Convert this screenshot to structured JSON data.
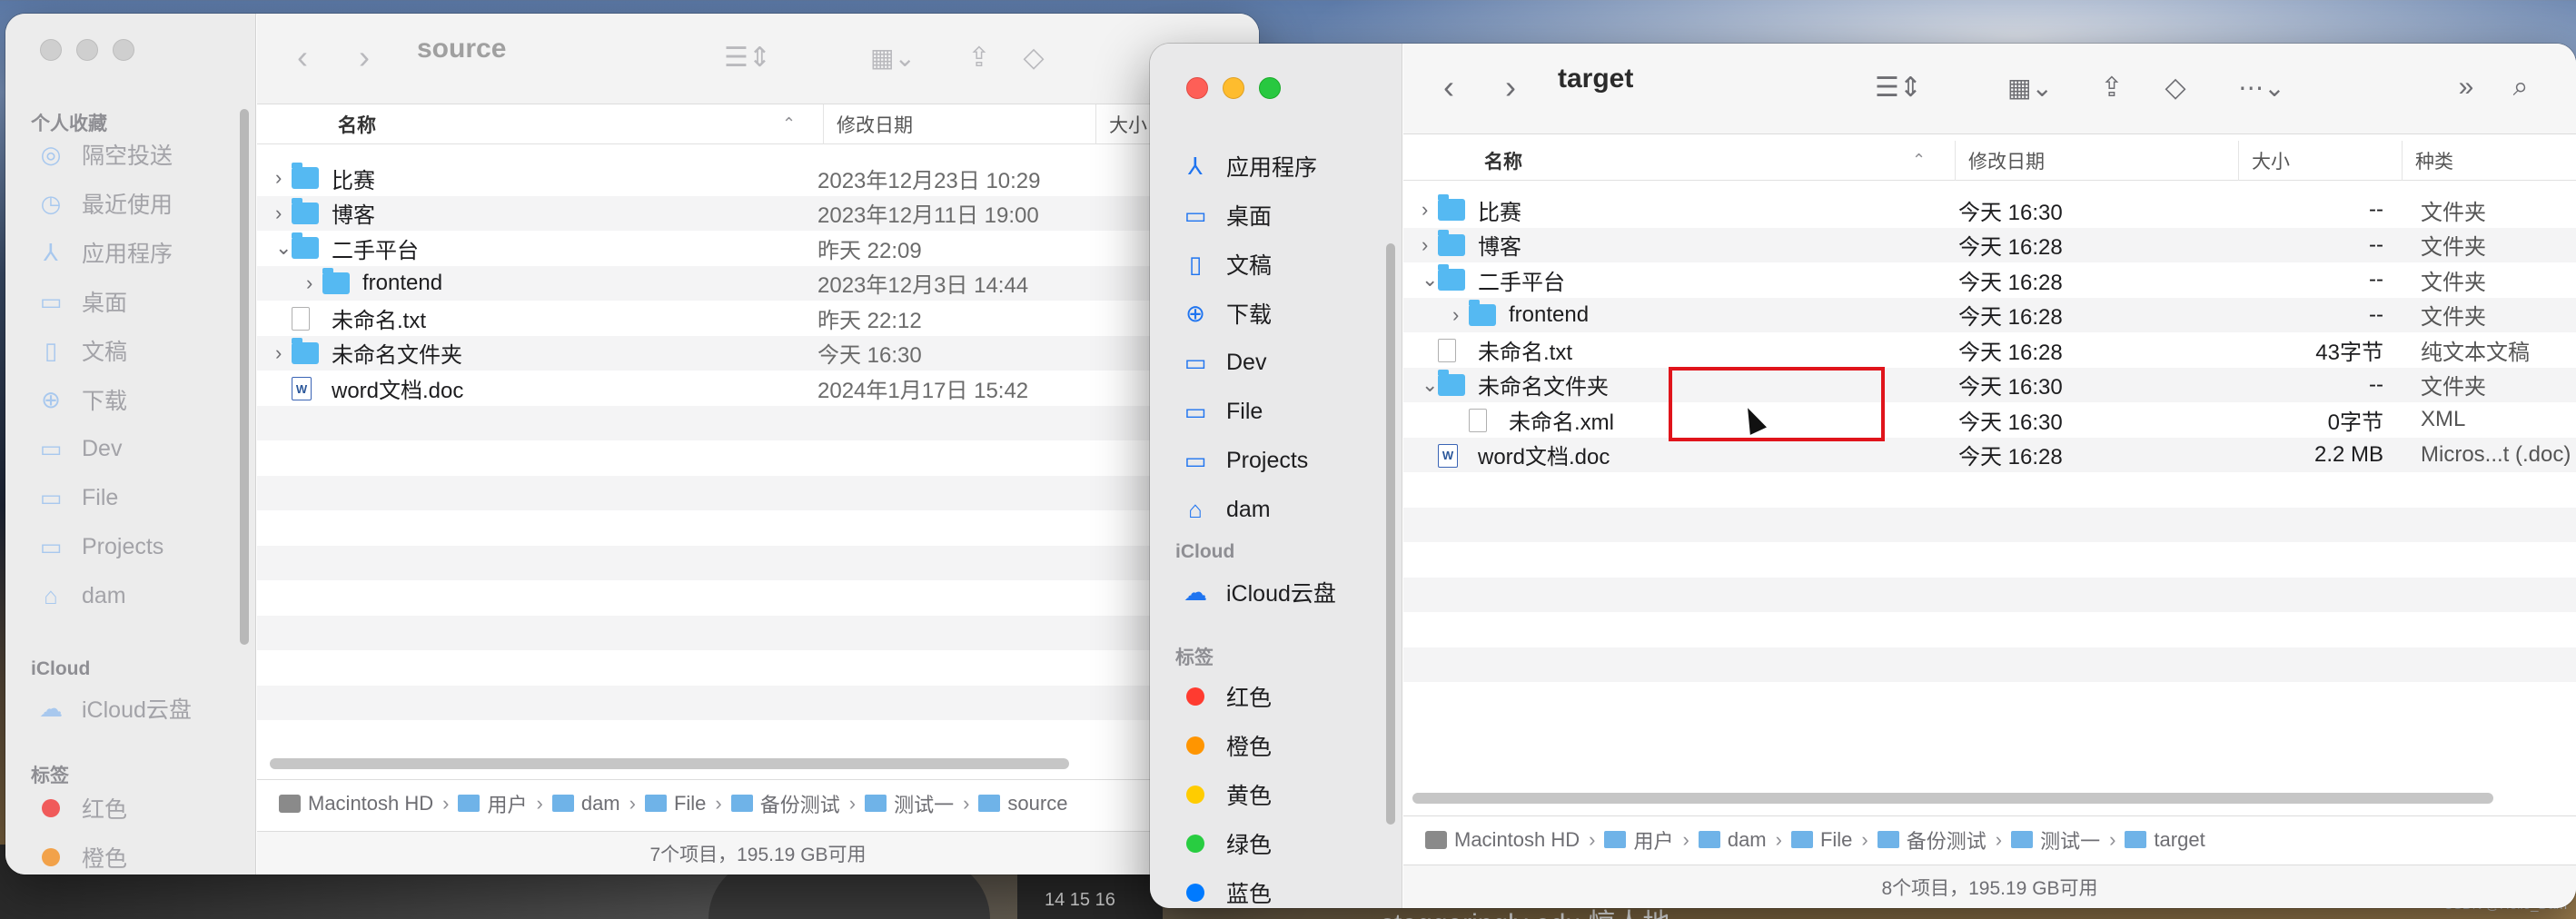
{
  "desktop": {
    "text": "staggeringly  edu  惊人地",
    "calendar": "14 15 16",
    "watermark": "CSDN @Hello_Dam"
  },
  "source": {
    "title": "source",
    "sidebar": {
      "favorites_header": "个人收藏",
      "items": [
        {
          "label": "隔空投送",
          "icon": "airdrop-icon",
          "glyph": "◎"
        },
        {
          "label": "最近使用",
          "icon": "clock-icon",
          "glyph": "◷"
        },
        {
          "label": "应用程序",
          "icon": "apps-icon",
          "glyph": "⅄"
        },
        {
          "label": "桌面",
          "icon": "desktop-icon",
          "glyph": "▭"
        },
        {
          "label": "文稿",
          "icon": "document-icon",
          "glyph": "▯"
        },
        {
          "label": "下载",
          "icon": "download-icon",
          "glyph": "⊕"
        },
        {
          "label": "Dev",
          "icon": "folder-icon",
          "glyph": "▭"
        },
        {
          "label": "File",
          "icon": "folder-icon",
          "glyph": "▭"
        },
        {
          "label": "Projects",
          "icon": "folder-icon",
          "glyph": "▭"
        },
        {
          "label": "dam",
          "icon": "home-icon",
          "glyph": "⌂"
        }
      ],
      "icloud_header": "iCloud",
      "icloud_item": "iCloud云盘",
      "tags_header": "标签",
      "tags": [
        {
          "label": "红色",
          "color": "#f05a5a"
        },
        {
          "label": "橙色",
          "color": "#f2a24a"
        }
      ]
    },
    "columns": {
      "name": "名称",
      "date": "修改日期",
      "size": "大小"
    },
    "files": [
      {
        "name": "比赛",
        "kind": "folder",
        "date": "2023年12月23日 10:29",
        "expand": "›",
        "indent": 0
      },
      {
        "name": "博客",
        "kind": "folder",
        "date": "2023年12月11日 19:00",
        "expand": "›",
        "indent": 0
      },
      {
        "name": "二手平台",
        "kind": "folder",
        "date": "昨天 22:09",
        "expand": "⌄",
        "indent": 0
      },
      {
        "name": "frontend",
        "kind": "folder",
        "date": "2023年12月3日 14:44",
        "expand": "›",
        "indent": 1
      },
      {
        "name": "未命名.txt",
        "kind": "doc",
        "date": "昨天 22:12",
        "expand": "",
        "indent": 0
      },
      {
        "name": "未命名文件夹",
        "kind": "folder",
        "date": "今天 16:30",
        "expand": "›",
        "indent": 0
      },
      {
        "name": "word文档.doc",
        "kind": "word",
        "date": "2024年1月17日 15:42",
        "expand": "",
        "indent": 0
      }
    ],
    "path": [
      "Macintosh HD",
      "用户",
      "dam",
      "File",
      "备份测试",
      "测试一",
      "source"
    ],
    "status": "7个项目，195.19 GB可用"
  },
  "target": {
    "title": "target",
    "sidebar": {
      "items": [
        {
          "label": "应用程序",
          "icon": "apps-icon",
          "glyph": "⅄"
        },
        {
          "label": "桌面",
          "icon": "desktop-icon",
          "glyph": "▭"
        },
        {
          "label": "文稿",
          "icon": "document-icon",
          "glyph": "▯"
        },
        {
          "label": "下载",
          "icon": "download-icon",
          "glyph": "⊕"
        },
        {
          "label": "Dev",
          "icon": "folder-icon",
          "glyph": "▭"
        },
        {
          "label": "File",
          "icon": "folder-icon",
          "glyph": "▭"
        },
        {
          "label": "Projects",
          "icon": "folder-icon",
          "glyph": "▭"
        },
        {
          "label": "dam",
          "icon": "home-icon",
          "glyph": "⌂"
        }
      ],
      "icloud_header": "iCloud",
      "icloud_item": "iCloud云盘",
      "tags_header": "标签",
      "tags": [
        {
          "label": "红色",
          "color": "#ff3b30"
        },
        {
          "label": "橙色",
          "color": "#ff9500"
        },
        {
          "label": "黄色",
          "color": "#ffcc00"
        },
        {
          "label": "绿色",
          "color": "#28cd41"
        },
        {
          "label": "蓝色",
          "color": "#007aff"
        }
      ]
    },
    "columns": {
      "name": "名称",
      "date": "修改日期",
      "size": "大小",
      "kind": "种类"
    },
    "files": [
      {
        "name": "比赛",
        "kind": "folder",
        "date": "今天 16:30",
        "size": "--",
        "type": "文件夹",
        "expand": "›",
        "indent": 0
      },
      {
        "name": "博客",
        "kind": "folder",
        "date": "今天 16:28",
        "size": "--",
        "type": "文件夹",
        "expand": "›",
        "indent": 0
      },
      {
        "name": "二手平台",
        "kind": "folder",
        "date": "今天 16:28",
        "size": "--",
        "type": "文件夹",
        "expand": "⌄",
        "indent": 0
      },
      {
        "name": "frontend",
        "kind": "folder",
        "date": "今天 16:28",
        "size": "--",
        "type": "文件夹",
        "expand": "›",
        "indent": 1
      },
      {
        "name": "未命名.txt",
        "kind": "doc",
        "date": "今天 16:28",
        "size": "43字节",
        "type": "纯文本文稿",
        "expand": "",
        "indent": 0
      },
      {
        "name": "未命名文件夹",
        "kind": "folder",
        "date": "今天 16:30",
        "size": "--",
        "type": "文件夹",
        "expand": "⌄",
        "indent": 0
      },
      {
        "name": "未命名.xml",
        "kind": "doc",
        "date": "今天 16:30",
        "size": "0字节",
        "type": "XML",
        "expand": "",
        "indent": 1
      },
      {
        "name": "word文档.doc",
        "kind": "word",
        "date": "今天 16:28",
        "size": "2.2 MB",
        "type": "Micros...t (.doc)",
        "expand": "",
        "indent": 0
      }
    ],
    "path": [
      "Macintosh HD",
      "用户",
      "dam",
      "File",
      "备份测试",
      "测试一",
      "target"
    ],
    "status": "8个项目，195.19 GB可用"
  }
}
